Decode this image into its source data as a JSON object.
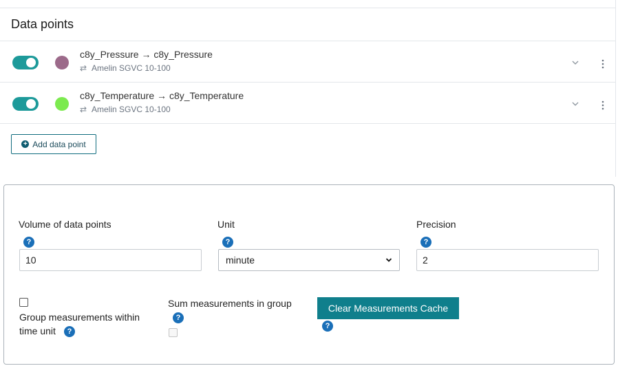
{
  "panel": {
    "title": "Data points"
  },
  "datapoints": [
    {
      "name": "c8y_Pressure → c8y_Pressure",
      "source": "Amelin SGVC 10-100",
      "color": "#9c6a8a",
      "enabled": true
    },
    {
      "name": "c8y_Temperature → c8y_Temperature",
      "source": "Amelin SGVC 10-100",
      "color": "#7cea4f",
      "enabled": true
    }
  ],
  "add_button": {
    "label": "Add data point"
  },
  "settings": {
    "volume": {
      "label": "Volume of data points",
      "value": "10"
    },
    "unit": {
      "label": "Unit",
      "value": "minute"
    },
    "precision": {
      "label": "Precision",
      "value": "2"
    },
    "group": {
      "label": "Group measurements within time unit",
      "checked": false
    },
    "sum": {
      "label": "Sum measurements in group",
      "checked": false,
      "disabled": true
    },
    "clear_button": {
      "label": "Clear Measurements Cache"
    },
    "help_glyph": "?"
  },
  "colors": {
    "accent": "#0f7f8c",
    "toggle": "#1d9a9a",
    "help": "#1a6fb8"
  }
}
